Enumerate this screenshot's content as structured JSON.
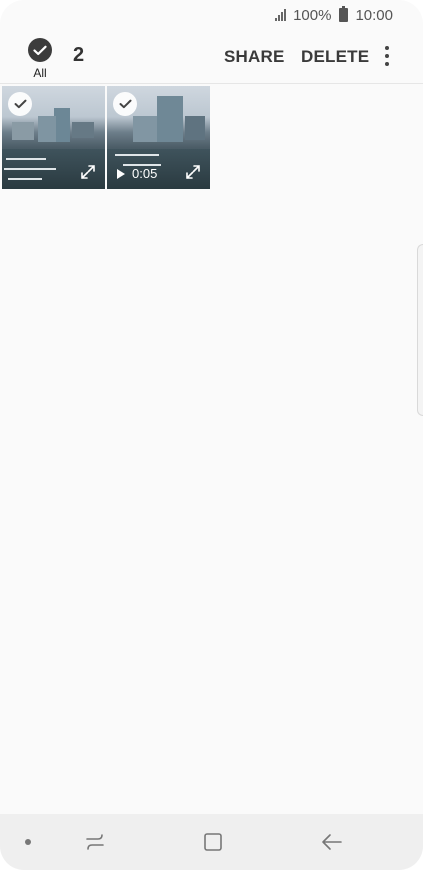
{
  "status_bar": {
    "battery": "100%",
    "time": "10:00"
  },
  "action_bar": {
    "select_all_label": "All",
    "selected_count": "2",
    "share_label": "SHARE",
    "delete_label": "DELETE"
  },
  "media": [
    {
      "type": "photo",
      "selected": true
    },
    {
      "type": "video",
      "selected": true,
      "duration": "0:05"
    }
  ],
  "nav_bar": {
    "icons": [
      "recents-icon",
      "home-icon",
      "back-icon"
    ]
  },
  "colors": {
    "background": "#fafafa",
    "action_text": "#3a3a3a",
    "check_dark": "#3c3c3c",
    "nav_background": "#efefef"
  }
}
